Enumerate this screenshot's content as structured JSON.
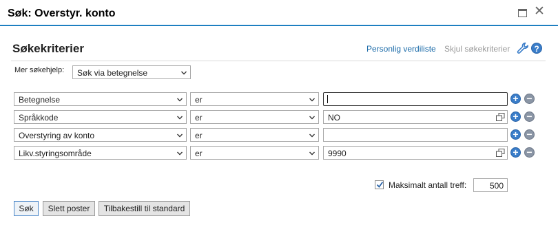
{
  "window": {
    "title": "Søk: Overstyr. konto"
  },
  "header": {
    "section_title": "Søkekriterier",
    "personal_value_list_link": "Personlig verdiliste",
    "hide_criteria_link": "Skjul søkekriterier",
    "help_label": "?"
  },
  "search_help": {
    "label": "Mer søkehjelp:",
    "selected": "Søk via betegnelse"
  },
  "criteria": [
    {
      "field": "Betegnelse",
      "operator": "er",
      "value": "",
      "has_value_help": false,
      "focused": true
    },
    {
      "field": "Språkkode",
      "operator": "er",
      "value": "NO",
      "has_value_help": true,
      "focused": false
    },
    {
      "field": "Overstyring av konto",
      "operator": "er",
      "value": "",
      "has_value_help": false,
      "focused": false
    },
    {
      "field": "Likv.styringsområde",
      "operator": "er",
      "value": "9990",
      "has_value_help": true,
      "focused": false
    }
  ],
  "max_hits": {
    "checked": true,
    "label": "Maksimalt antall treff:",
    "value": "500"
  },
  "buttons": {
    "search": "Søk",
    "delete_entries": "Slett poster",
    "reset_default": "Tilbakestill til standard"
  },
  "colors": {
    "accent": "#1e7fc1",
    "link": "#1a6aa8",
    "add_button": "#3a7dc9",
    "remove_button": "#8a95a5"
  }
}
